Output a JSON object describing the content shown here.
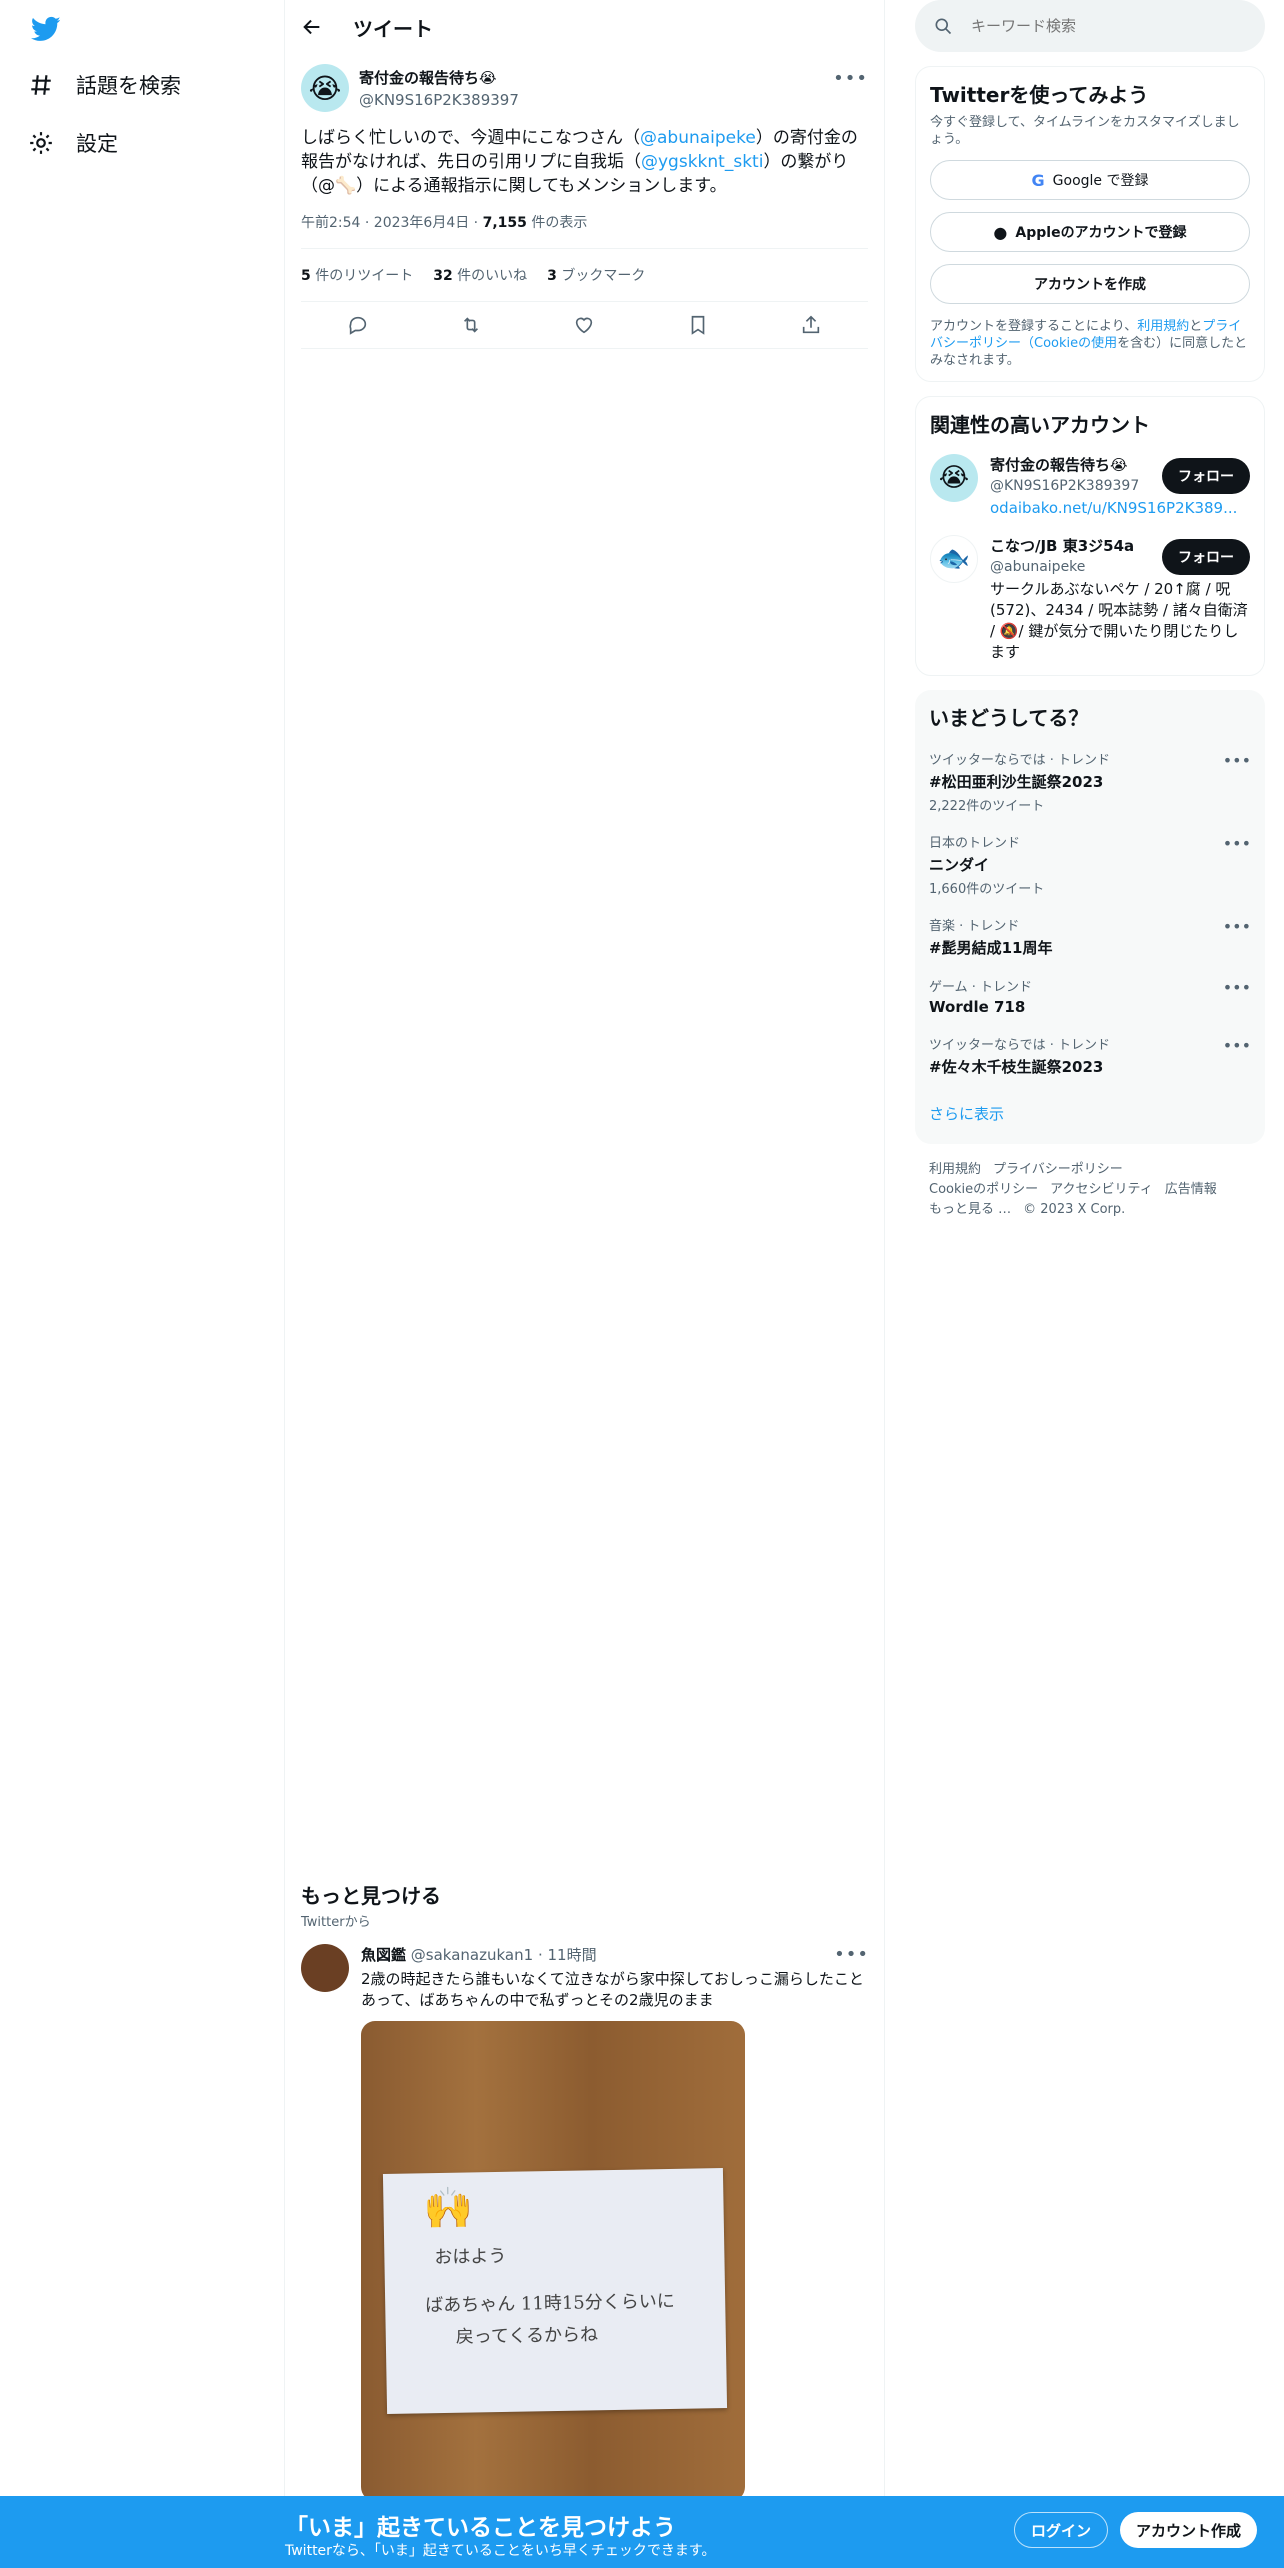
{
  "nav": {
    "items": [
      {
        "label": "話題を検索",
        "icon": "hashtag-icon"
      },
      {
        "label": "設定",
        "icon": "gear-icon"
      }
    ]
  },
  "header": {
    "title": "ツイート"
  },
  "tweet": {
    "name": "寄付金の報告待ち😭",
    "handle": "@KN9S16P2K389397",
    "text_parts": [
      "しばらく忙しいので、今週中にこなつさん（",
      "@abunaipeke",
      "）の寄付金の報告がなければ、先日の引用リプに自我垢（",
      "@ygskknt_skti",
      "）の繋がり（@🦴）による通報指示に関してもメンションします。"
    ],
    "time": "午前2:54 · 2023年6月4日 · ",
    "views_count": "7,155",
    "views_label": " 件の表示",
    "retweets_count": "5",
    "retweets_label": " 件のリツイート",
    "likes_count": "32",
    "likes_label": " 件のいいね",
    "bookmarks_count": "3",
    "bookmarks_label": " ブックマーク"
  },
  "discover": {
    "title": "もっと見つける",
    "subtitle": "Twitterから",
    "post": {
      "name": "魚図鑑",
      "handle": "@sakanazukan1",
      "time": " · 11時間",
      "text": "2歳の時起きたら誰もいなくて泣きながら家中探しておしっこ漏らしたことあって、ばあちゃんの中で私ずっとその2歳児のまま",
      "image_lines": [
        "おはよう",
        "ばあちゃん  11時15分くらいに",
        "戻ってくるからね"
      ]
    }
  },
  "search": {
    "placeholder": "キーワード検索"
  },
  "signup_card": {
    "title": "Twitterを使ってみよう",
    "subtitle": "今すぐ登録して、タイムラインをカスタマイズしましょう。",
    "google": "Google で登録",
    "apple": "Appleのアカウントで登録",
    "create": "アカウントを作成",
    "legal_prefix": "アカウントを登録することにより、",
    "terms": "利用規約",
    "and": "と",
    "privacy": "プライバシーポリシー（Cookieの使用",
    "legal_suffix": "を含む）に同意したとみなされます。"
  },
  "related": {
    "title": "関連性の高いアカウント",
    "accounts": [
      {
        "name": "寄付金の報告待ち😭",
        "handle": "@KN9S16P2K389397",
        "bio": "odaibako.net/u/KN9S16P2K389...",
        "follow": "フォロー"
      },
      {
        "name": "こなつ/JB 東3ジ54a",
        "handle": "@abunaipeke",
        "bio": "サークルあぶないペケ / 20↑腐 / 呪(572)、2434 / 呪本誌勢 / 諸々自衛済 / 🔕/ 鍵が気分で開いたり閉じたりします",
        "follow": "フォロー"
      }
    ]
  },
  "trends": {
    "title": "いまどうしてる？",
    "items": [
      {
        "context": "ツイッターならでは · トレンド",
        "name": "#松田亜利沙生誕祭2023",
        "count": "2,222件のツイート"
      },
      {
        "context": "日本のトレンド",
        "name": "ニンダイ",
        "count": "1,660件のツイート"
      },
      {
        "context": "音楽 · トレンド",
        "name": "#髭男結成11周年",
        "count": ""
      },
      {
        "context": "ゲーム · トレンド",
        "name": "Wordle 718",
        "count": ""
      },
      {
        "context": "ツイッターならでは · トレンド",
        "name": "#佐々木千枝生誕祭2023",
        "count": ""
      }
    ],
    "show_more": "さらに表示"
  },
  "footer": {
    "links1": [
      "利用規約",
      "プライバシーポリシー"
    ],
    "links2": [
      "Cookieのポリシー",
      "アクセシビリティ",
      "広告情報"
    ],
    "more": "もっと見る …",
    "copyright": "© 2023 X Corp."
  },
  "bottombar": {
    "title": "「いま」起きていることを見つけよう",
    "subtitle": "Twitterなら、「いま」起きていることをいち早くチェックできます。",
    "login": "ログイン",
    "signup": "アカウント作成"
  },
  "colors": {
    "accent": "#1d9bf0",
    "text": "#0f1419",
    "secondary": "#536471"
  }
}
